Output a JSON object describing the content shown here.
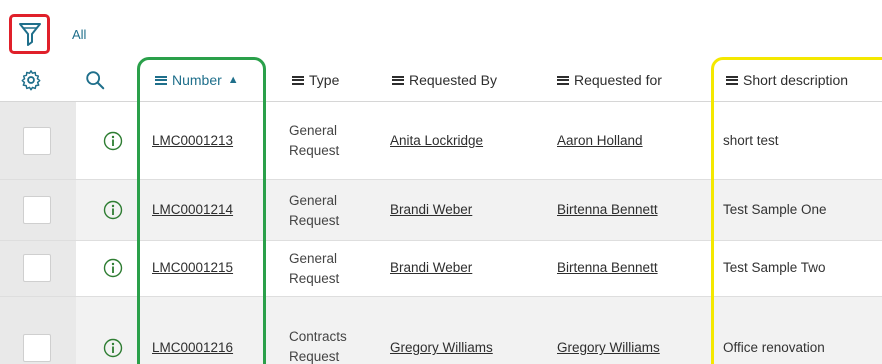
{
  "toolbar": {
    "filter_icon": "filter-funnel-icon",
    "filter_label": "All"
  },
  "header": {
    "settings_icon": "gear-icon",
    "search_icon": "search-icon",
    "columns": [
      {
        "label": "Number",
        "sorted": "ascending"
      },
      {
        "label": "Type"
      },
      {
        "label": "Requested By"
      },
      {
        "label": "Requested for"
      },
      {
        "label": "Short description"
      }
    ]
  },
  "rows": [
    {
      "number": "LMC0001213",
      "type_line1": "General",
      "type_line2": "Request",
      "requested_by": "Anita Lockridge",
      "requested_for": "Aaron Holland",
      "short_description": "short test"
    },
    {
      "number": "LMC0001214",
      "type_line1": "General",
      "type_line2": "Request",
      "requested_by": "Brandi Weber",
      "requested_for": "Birtenna Bennett",
      "short_description": "Test Sample One"
    },
    {
      "number": "LMC0001215",
      "type_line1": "General",
      "type_line2": "Request",
      "requested_by": "Brandi Weber",
      "requested_for": "Birtenna Bennett",
      "short_description": "Test Sample Two"
    },
    {
      "number": "LMC0001216",
      "type_line1": "Contracts",
      "type_line2": "Request",
      "requested_by": "Gregory Williams",
      "requested_for": "Gregory Williams",
      "short_description": "Office renovation"
    }
  ],
  "colors": {
    "filter_highlight": "#e0202a",
    "number_column_highlight": "#2aa04a",
    "description_column_highlight": "#f4e800",
    "accent": "#1f6f8b"
  }
}
